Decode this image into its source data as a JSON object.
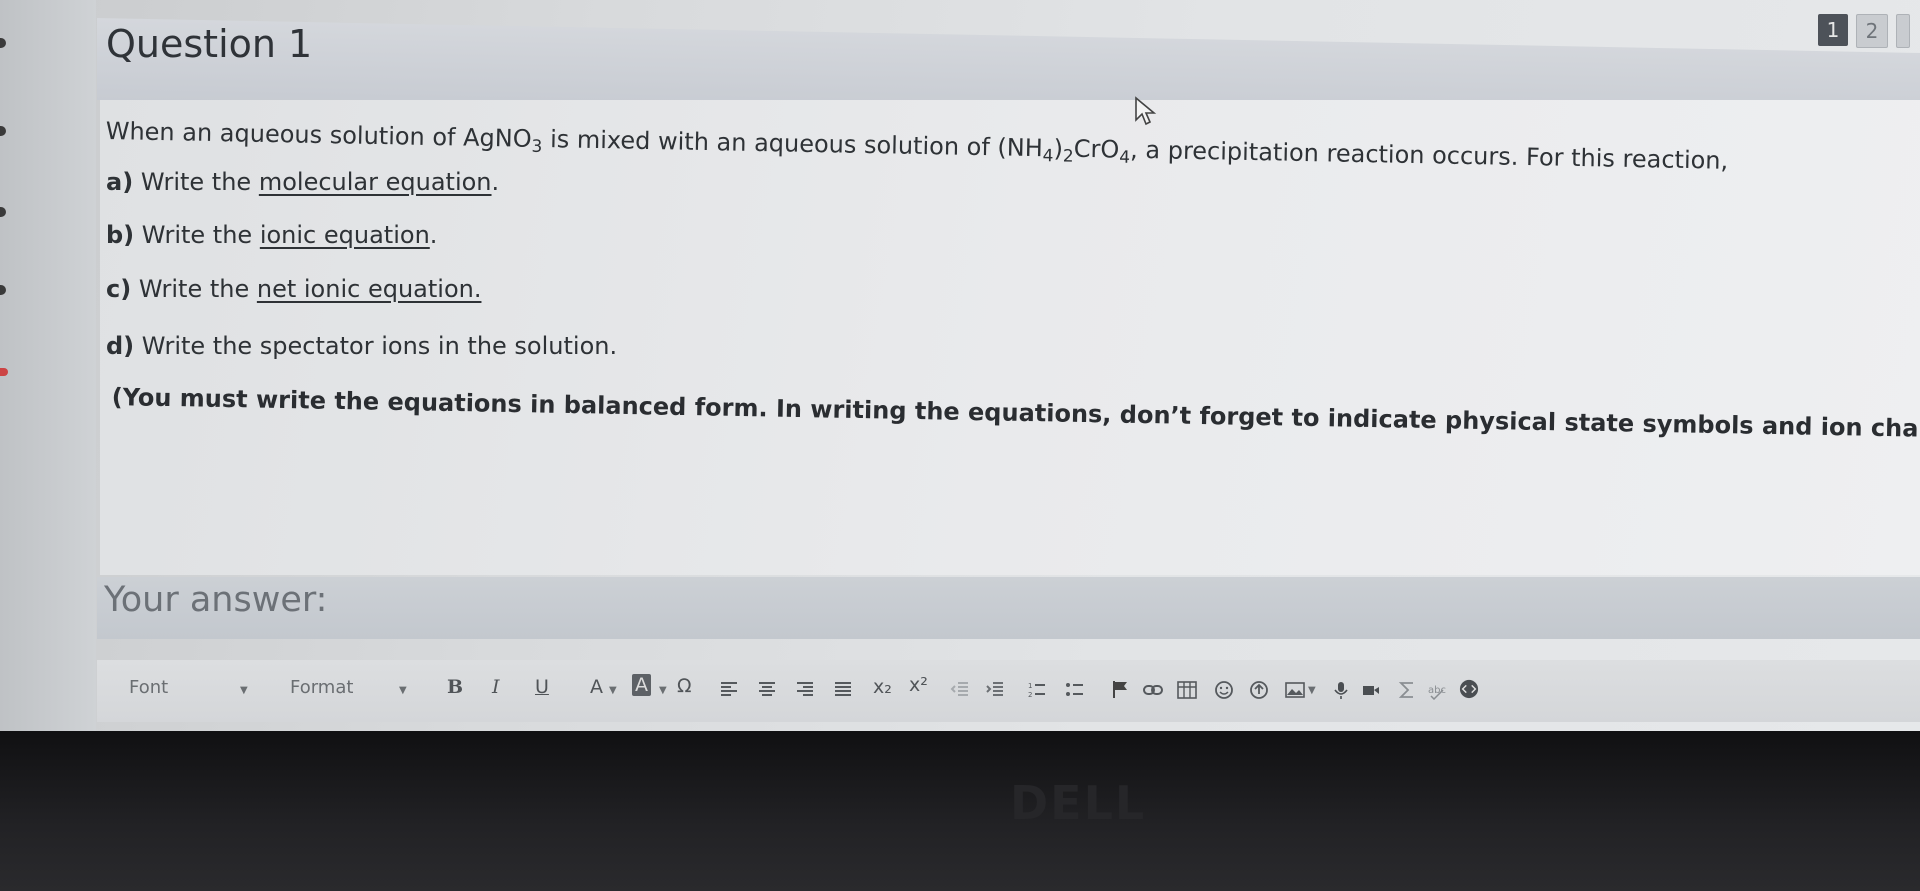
{
  "question": {
    "title": "Question 1",
    "pages": [
      "1",
      "2"
    ],
    "intro_part1": "When an aqueous solution of AgNO",
    "intro_sub1": "3",
    "intro_part2": " is mixed with an aqueous solution of (NH",
    "intro_sub2": "4",
    "intro_part3": ")",
    "intro_sub3": "2",
    "intro_part4": "CrO",
    "intro_sub4": "4",
    "intro_part5": ", a precipitation reaction occurs. For this reaction,",
    "parts": [
      {
        "letter": "a)",
        "text": "Write the",
        "link": "molecular equation",
        "end": "."
      },
      {
        "letter": "b)",
        "text": "Write the",
        "link": "ionic equation",
        "end": "."
      },
      {
        "letter": "c)",
        "text": "Write the",
        "link": "net ionic equation.",
        "end": ""
      },
      {
        "letter": "d)",
        "text": "Write the spectator ions in the solution.",
        "link": "",
        "end": ""
      }
    ],
    "instruction": "(You must write the equations in balanced form. In writing the equations, don’t forget to indicate physical state symbols and ion charges.)"
  },
  "answer": {
    "label": "Your answer:"
  },
  "toolbar": {
    "font_label": "Font",
    "format_label": "Format",
    "bold": "B",
    "italic": "I",
    "underline": "U",
    "text_color": "A",
    "bg_color": "A",
    "special_char": "Ω",
    "subscript": "x₂",
    "superscript": "x²",
    "icons": [
      "align-left-icon",
      "align-center-icon",
      "align-right-icon",
      "justify-icon",
      "outdent-icon",
      "indent-icon",
      "numbered-list-icon",
      "bulleted-list-icon",
      "flag-icon",
      "link-icon",
      "table-icon",
      "emoji-icon",
      "image-upload-icon",
      "image-icon",
      "microphone-icon",
      "video-icon",
      "sigma-icon",
      "spellcheck-icon",
      "source-code-icon"
    ]
  },
  "monitor": {
    "brand": "DELL"
  }
}
